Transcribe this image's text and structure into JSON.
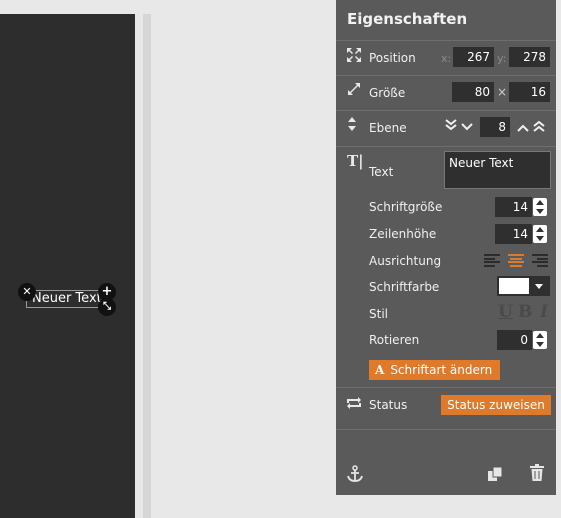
{
  "canvas": {
    "element_text": "Neuer Text"
  },
  "panel": {
    "title": "Eigenschaften",
    "position": {
      "label": "Position",
      "x_label": "x:",
      "x": "267",
      "y_label": "y:",
      "y": "278"
    },
    "size": {
      "label": "Größe",
      "width": "80",
      "times": "×",
      "height": "16"
    },
    "layer": {
      "label": "Ebene",
      "value": "8"
    },
    "text": {
      "label": "Text",
      "value": "Neuer Text"
    },
    "font_size": {
      "label": "Schriftgröße",
      "value": "14"
    },
    "line_height": {
      "label": "Zeilenhöhe",
      "value": "14"
    },
    "alignment": {
      "label": "Ausrichtung",
      "selected": "center"
    },
    "font_color": {
      "label": "Schriftfarbe",
      "value": "#ffffff"
    },
    "style": {
      "label": "Stil",
      "underline": "U",
      "bold": "B",
      "italic": "I"
    },
    "rotate": {
      "label": "Rotieren",
      "value": "0"
    },
    "change_font_button": {
      "icon": "A",
      "label": "Schriftart ändern"
    },
    "status": {
      "label": "Status",
      "button_label": "Status zuweisen"
    }
  },
  "icons": {
    "position": "move-icon",
    "size": "resize-icon",
    "layer": "layer-icon",
    "text": "text-cursor-icon",
    "status": "refresh-icon",
    "anchor": "anchor-icon",
    "duplicate": "copy-icon",
    "delete": "trash-icon"
  },
  "colors": {
    "accent": "#e07a2b",
    "panel_bg": "#5a5a5a",
    "canvas_bg": "#2d2d2d"
  }
}
